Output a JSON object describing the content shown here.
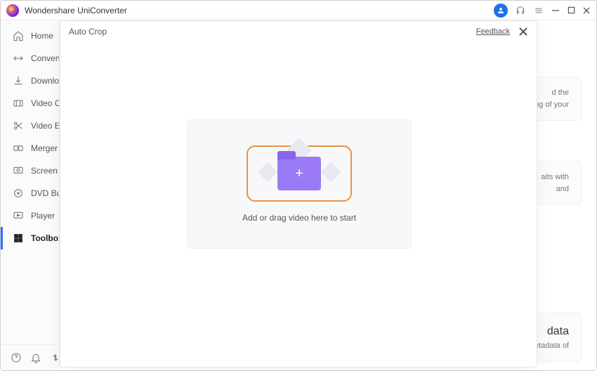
{
  "app": {
    "title": "Wondershare UniConverter"
  },
  "sidebar": {
    "items": [
      {
        "label": "Home"
      },
      {
        "label": "Converter"
      },
      {
        "label": "Downloader"
      },
      {
        "label": "Video Compressor"
      },
      {
        "label": "Video Editor"
      },
      {
        "label": "Merger"
      },
      {
        "label": "Screen Recorder"
      },
      {
        "label": "DVD Burner"
      },
      {
        "label": "Player"
      },
      {
        "label": "Toolbox"
      }
    ]
  },
  "modal": {
    "title": "Auto Crop",
    "feedback": "Feedback",
    "hint": "Add or drag video here to start"
  },
  "bg": {
    "c1": "d the\ning of your",
    "c2": "aits with\nand",
    "c3_title": "data",
    "c3_text": "etadata of"
  }
}
